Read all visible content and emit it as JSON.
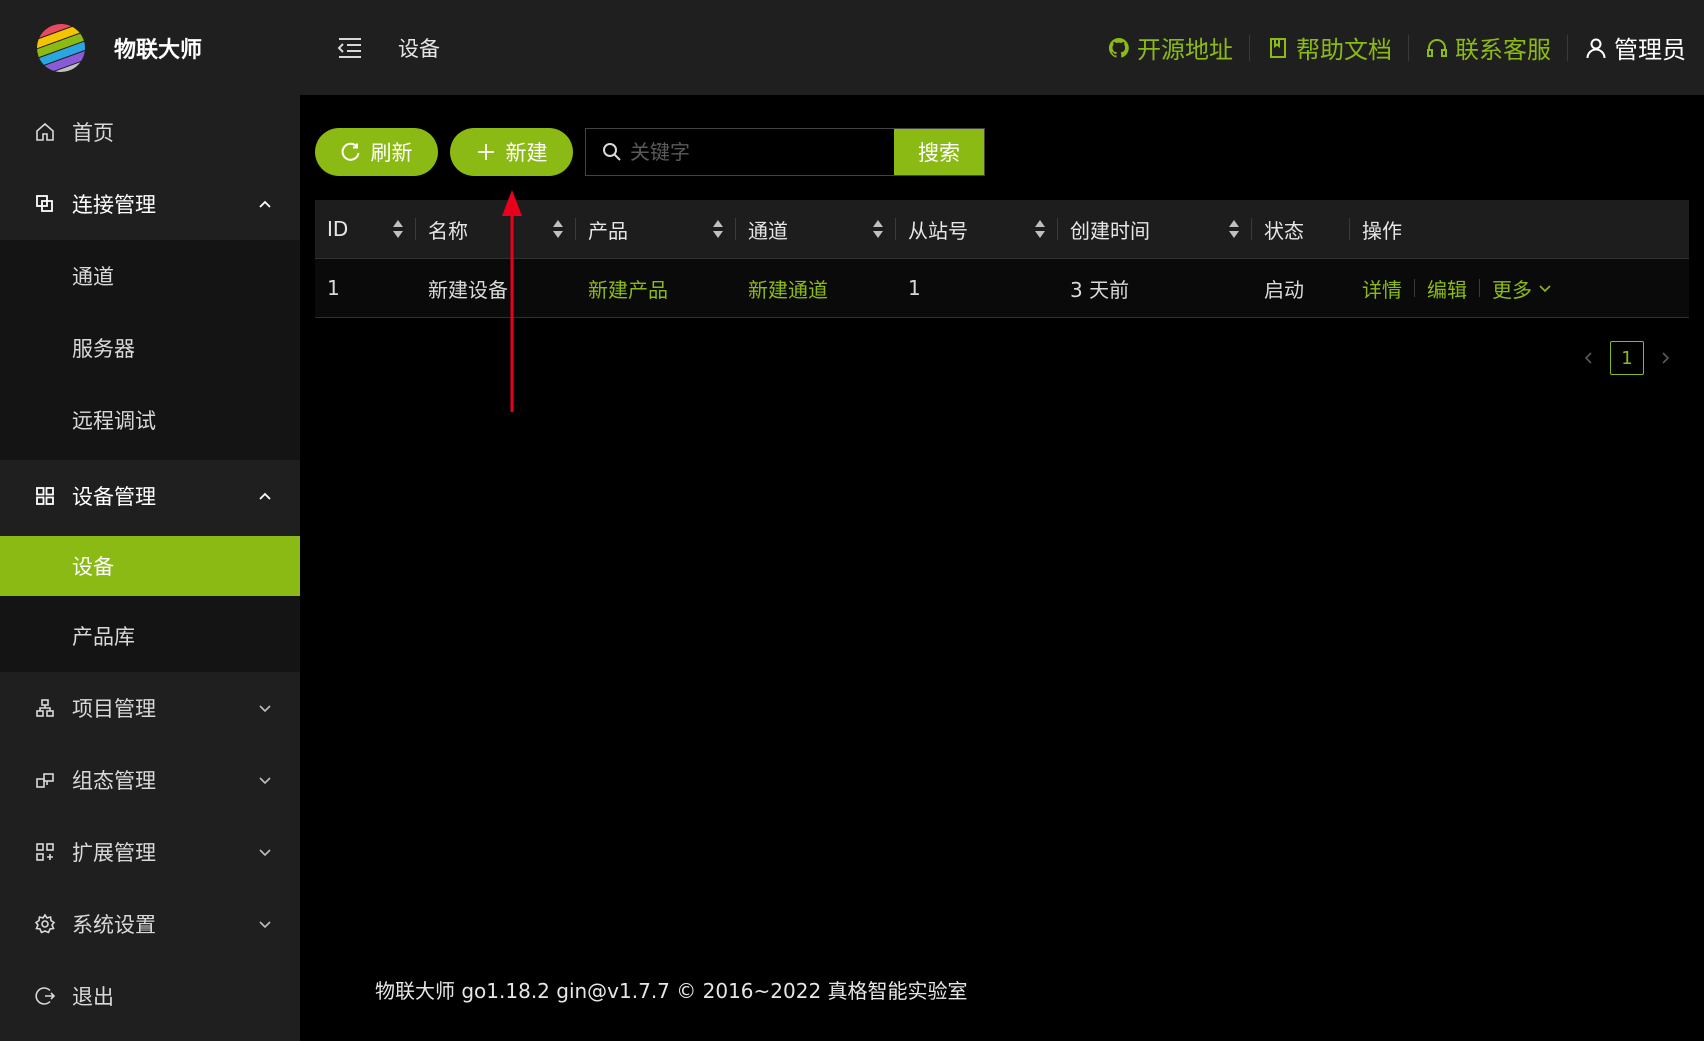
{
  "app": {
    "name": "物联大师"
  },
  "sidebar": {
    "items": [
      {
        "label": "首页",
        "icon": "home-icon"
      },
      {
        "label": "连接管理",
        "icon": "connection-icon",
        "expanded": true,
        "children": [
          {
            "label": "通道"
          },
          {
            "label": "服务器"
          },
          {
            "label": "远程调试"
          }
        ]
      },
      {
        "label": "设备管理",
        "icon": "device-grid-icon",
        "expanded": true,
        "children": [
          {
            "label": "设备",
            "active": true
          },
          {
            "label": "产品库"
          }
        ]
      },
      {
        "label": "项目管理",
        "icon": "project-icon",
        "expanded": false
      },
      {
        "label": "组态管理",
        "icon": "config-icon",
        "expanded": false
      },
      {
        "label": "扩展管理",
        "icon": "extension-icon",
        "expanded": false
      },
      {
        "label": "系统设置",
        "icon": "gear-icon",
        "expanded": false
      },
      {
        "label": "退出",
        "icon": "logout-icon"
      }
    ]
  },
  "header": {
    "breadcrumb": "设备",
    "links": [
      {
        "label": "开源地址",
        "icon": "github-icon"
      },
      {
        "label": "帮助文档",
        "icon": "book-icon"
      },
      {
        "label": "联系客服",
        "icon": "headset-icon"
      },
      {
        "label": "管理员",
        "icon": "user-icon"
      }
    ]
  },
  "toolbar": {
    "refresh_label": "刷新",
    "new_label": "新建",
    "search_placeholder": "关键字",
    "search_value": "",
    "search_button": "搜索"
  },
  "table": {
    "columns": [
      "ID",
      "名称",
      "产品",
      "通道",
      "从站号",
      "创建时间",
      "状态",
      "操作"
    ],
    "rows": [
      {
        "id": "1",
        "name": "新建设备",
        "product": "新建产品",
        "channel": "新建通道",
        "slave": "1",
        "created": "3 天前",
        "status": "启动",
        "actions": {
          "detail": "详情",
          "edit": "编辑",
          "more": "更多"
        }
      }
    ]
  },
  "pagination": {
    "current": "1"
  },
  "footer": {
    "text": "物联大师 go1.18.2 gin@v1.7.7 © 2016~2022 真格智能实验室"
  },
  "colors": {
    "accent": "#8cba14",
    "annotation_arrow": "#e8001c",
    "sidebar_bg": "#1f1f1f"
  }
}
